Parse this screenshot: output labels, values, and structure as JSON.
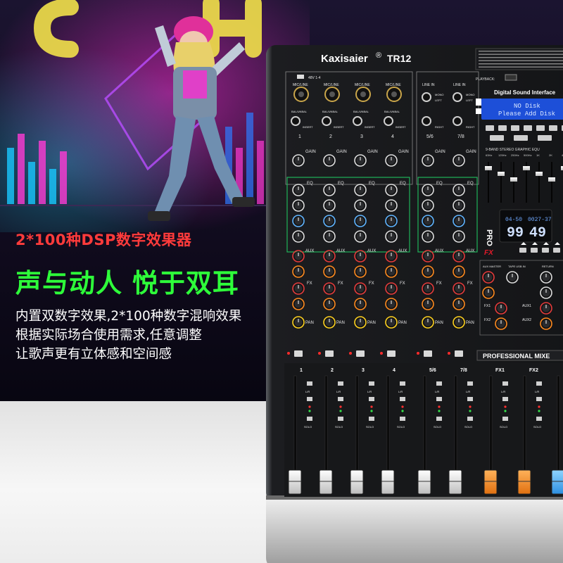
{
  "promo": {
    "headline_red": "2*100种DSP数字效果器",
    "headline_green": "声与动人 悦于双耳",
    "description": [
      "内置双数字效果,2*100种数字混响效果",
      "根据实际场合使用需求,任意调整",
      "让歌声更有立体感和空间感"
    ]
  },
  "mixer": {
    "brand": "Kaxisaier",
    "registered": "®",
    "model": "TR12",
    "phantom_label": "48V 1-4",
    "mic_label": "MIC/LINE",
    "line_in_label": "LINE IN",
    "bal_label": "BAL/UNBAL",
    "insert_label": "INSERT",
    "channels": [
      "1",
      "2",
      "3",
      "4",
      "5/6",
      "7/8"
    ],
    "gain_label": "GAIN",
    "eq_label": "EQ",
    "aux_label": "AUX",
    "fx_label": "FX",
    "pan_label": "PAN",
    "mono_label": "MONO",
    "left_label": "LEFT",
    "right_label": "RIGHT",
    "playback_label": "PLAYBACK:",
    "dsi_label": "Digital Sound Interface",
    "lcd_line1": "NO  Disk",
    "lcd_line2": "Please Add Disk",
    "eq_title": "9-BAND STEREO GRAPHIC EQU",
    "eq_bands": [
      "63Hz",
      "125Hz",
      "250Hz",
      "500Hz",
      "1K",
      "2K",
      "4K"
    ],
    "pro_label": "PRO",
    "fx_logo": "FX",
    "display_small_left": "04-50",
    "display_small_right": "0027-37",
    "display_big_left": "99",
    "display_big_right": "49",
    "aux_master_label": "AUX MASTER",
    "tape_label": "TAPE USB IN",
    "return_label": "RETURN",
    "fx1_label": "FX1",
    "fx2_label": "FX2",
    "aux1_label": "AUX1",
    "aux2_label": "AUX2",
    "professional_label": "PROFESSIONAL MIXE",
    "fader_channels": [
      "1",
      "2",
      "3",
      "4",
      "5/6",
      "7/8",
      "FX1",
      "FX2"
    ],
    "solo_label": "SOLO",
    "lr_label": "L/R",
    "colors": {
      "red_text": "#ff3b3b",
      "green_text": "#2eff3a",
      "lcd_blue": "#2f6cff",
      "fx_fader": "#f08a24",
      "master_fader": "#3aa7ff"
    }
  }
}
